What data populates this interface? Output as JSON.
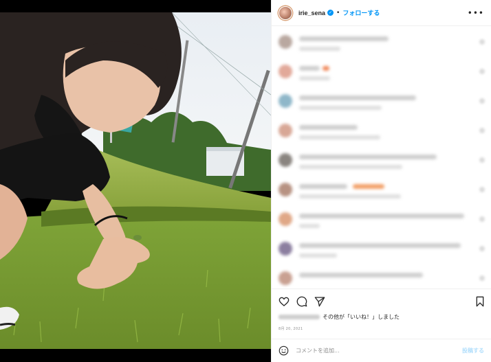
{
  "post": {
    "username": "irie_sena",
    "follow_label": "フォローする",
    "more_label": "•••",
    "likes_text": "その他が「いいね！」しました",
    "date": "8月 20, 2021",
    "comment_placeholder": "コメントを追加...",
    "post_label": "投稿する"
  },
  "icons": {
    "header": [
      "avatar",
      "verified-icon",
      "more-icon"
    ],
    "actions": [
      "heart-icon",
      "comment-icon",
      "share-icon",
      "bookmark-icon"
    ],
    "composer": [
      "emoji-icon"
    ]
  },
  "colors": {
    "accent": "#0095f6",
    "text": "#262626",
    "muted": "#8e8e8e",
    "border": "#efefef",
    "post_disabled": "#b2dffc"
  }
}
